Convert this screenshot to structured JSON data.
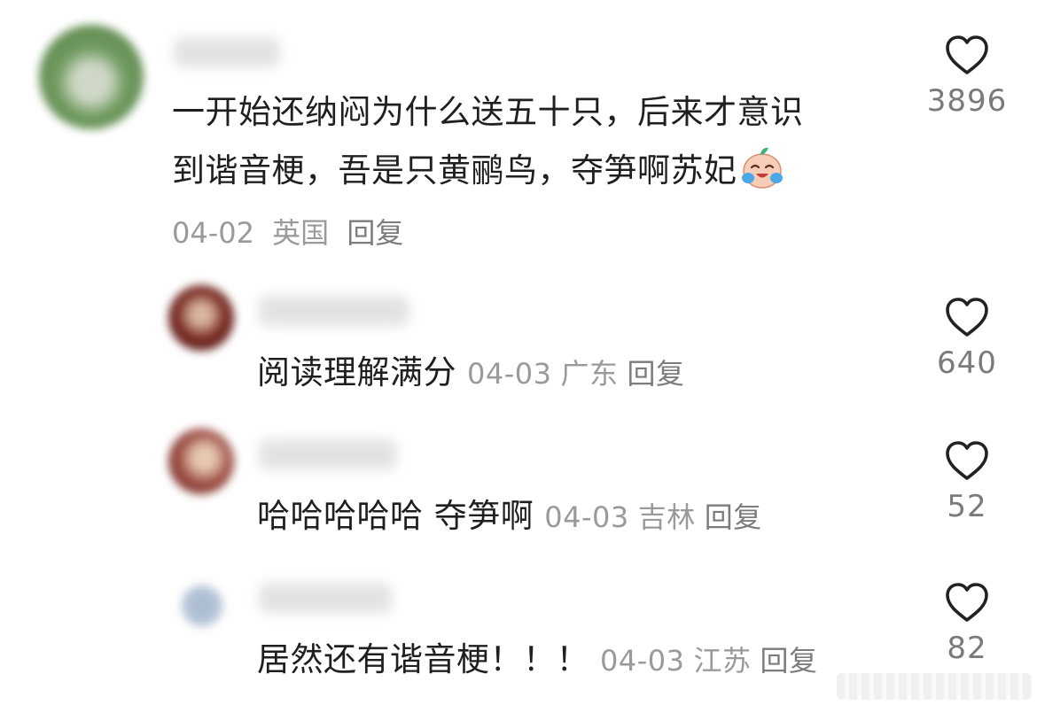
{
  "comments": [
    {
      "text_line1": "一开始还纳闷为什么送五十只，后来才意识",
      "text_line2": "到谐音梗，吾是只黄鹂鸟，夺笋啊苏妃",
      "emoji_icon": "laughing-crying-emoji-icon",
      "date": "04-02",
      "location": "英国",
      "reply_label": "回复",
      "likes": "3896",
      "avatar_color": "#6f9a5e"
    },
    {
      "text": "阅读理解满分",
      "date": "04-03",
      "location": "广东",
      "reply_label": "回复",
      "likes": "640",
      "avatar_color": "#7a2a22"
    },
    {
      "text": "哈哈哈哈哈 夺笋啊",
      "date": "04-03",
      "location": "吉林",
      "reply_label": "回复",
      "likes": "52",
      "avatar_color": "#9b4a40"
    },
    {
      "text": "居然还有谐音梗！！！",
      "date": "04-03",
      "location": "江苏",
      "reply_label": "回复",
      "likes": "82",
      "avatar_color": "#aebfd4"
    }
  ],
  "colors": {
    "text": "#1f1f1f",
    "meta": "#9a9a9a",
    "heart_outline": "#222222"
  }
}
